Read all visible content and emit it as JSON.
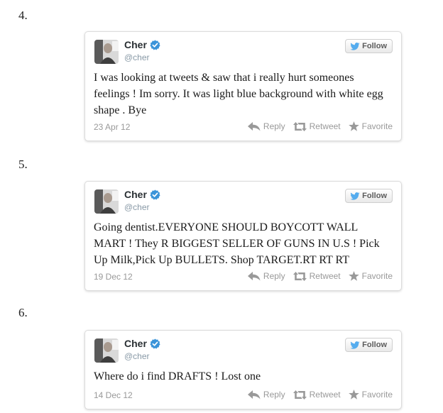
{
  "items": [
    {
      "number": "4.",
      "name": "Cher",
      "handle": "@cher",
      "follow_label": "Follow",
      "text": "I was looking at tweets & saw that i really hurt someones feelings ! Im sorry. It was light blue background with white egg shape . Bye",
      "date": "23 Apr 12",
      "reply_label": "Reply",
      "retweet_label": "Retweet",
      "favorite_label": "Favorite"
    },
    {
      "number": "5.",
      "name": "Cher",
      "handle": "@cher",
      "follow_label": "Follow",
      "text": "Going dentist.EVERYONE SHOULD BOYCOTT WALL MART ! They R BIGGEST SELLER OF GUNS IN U.S ! Pick Up Milk,Pick Up BULLETS. Shop TARGET.RT RT RT",
      "date": "19 Dec 12",
      "reply_label": "Reply",
      "retweet_label": "Retweet",
      "favorite_label": "Favorite"
    },
    {
      "number": "6.",
      "name": "Cher",
      "handle": "@cher",
      "follow_label": "Follow",
      "text": "Where do i find DRAFTS ! Lost one",
      "date": "14 Dec 12",
      "reply_label": "Reply",
      "retweet_label": "Retweet",
      "favorite_label": "Favorite"
    }
  ],
  "colors": {
    "verified": "#3b94d9",
    "twitter_bird": "#55acee",
    "action_gray": "#999999",
    "name_text": "#292f33"
  }
}
